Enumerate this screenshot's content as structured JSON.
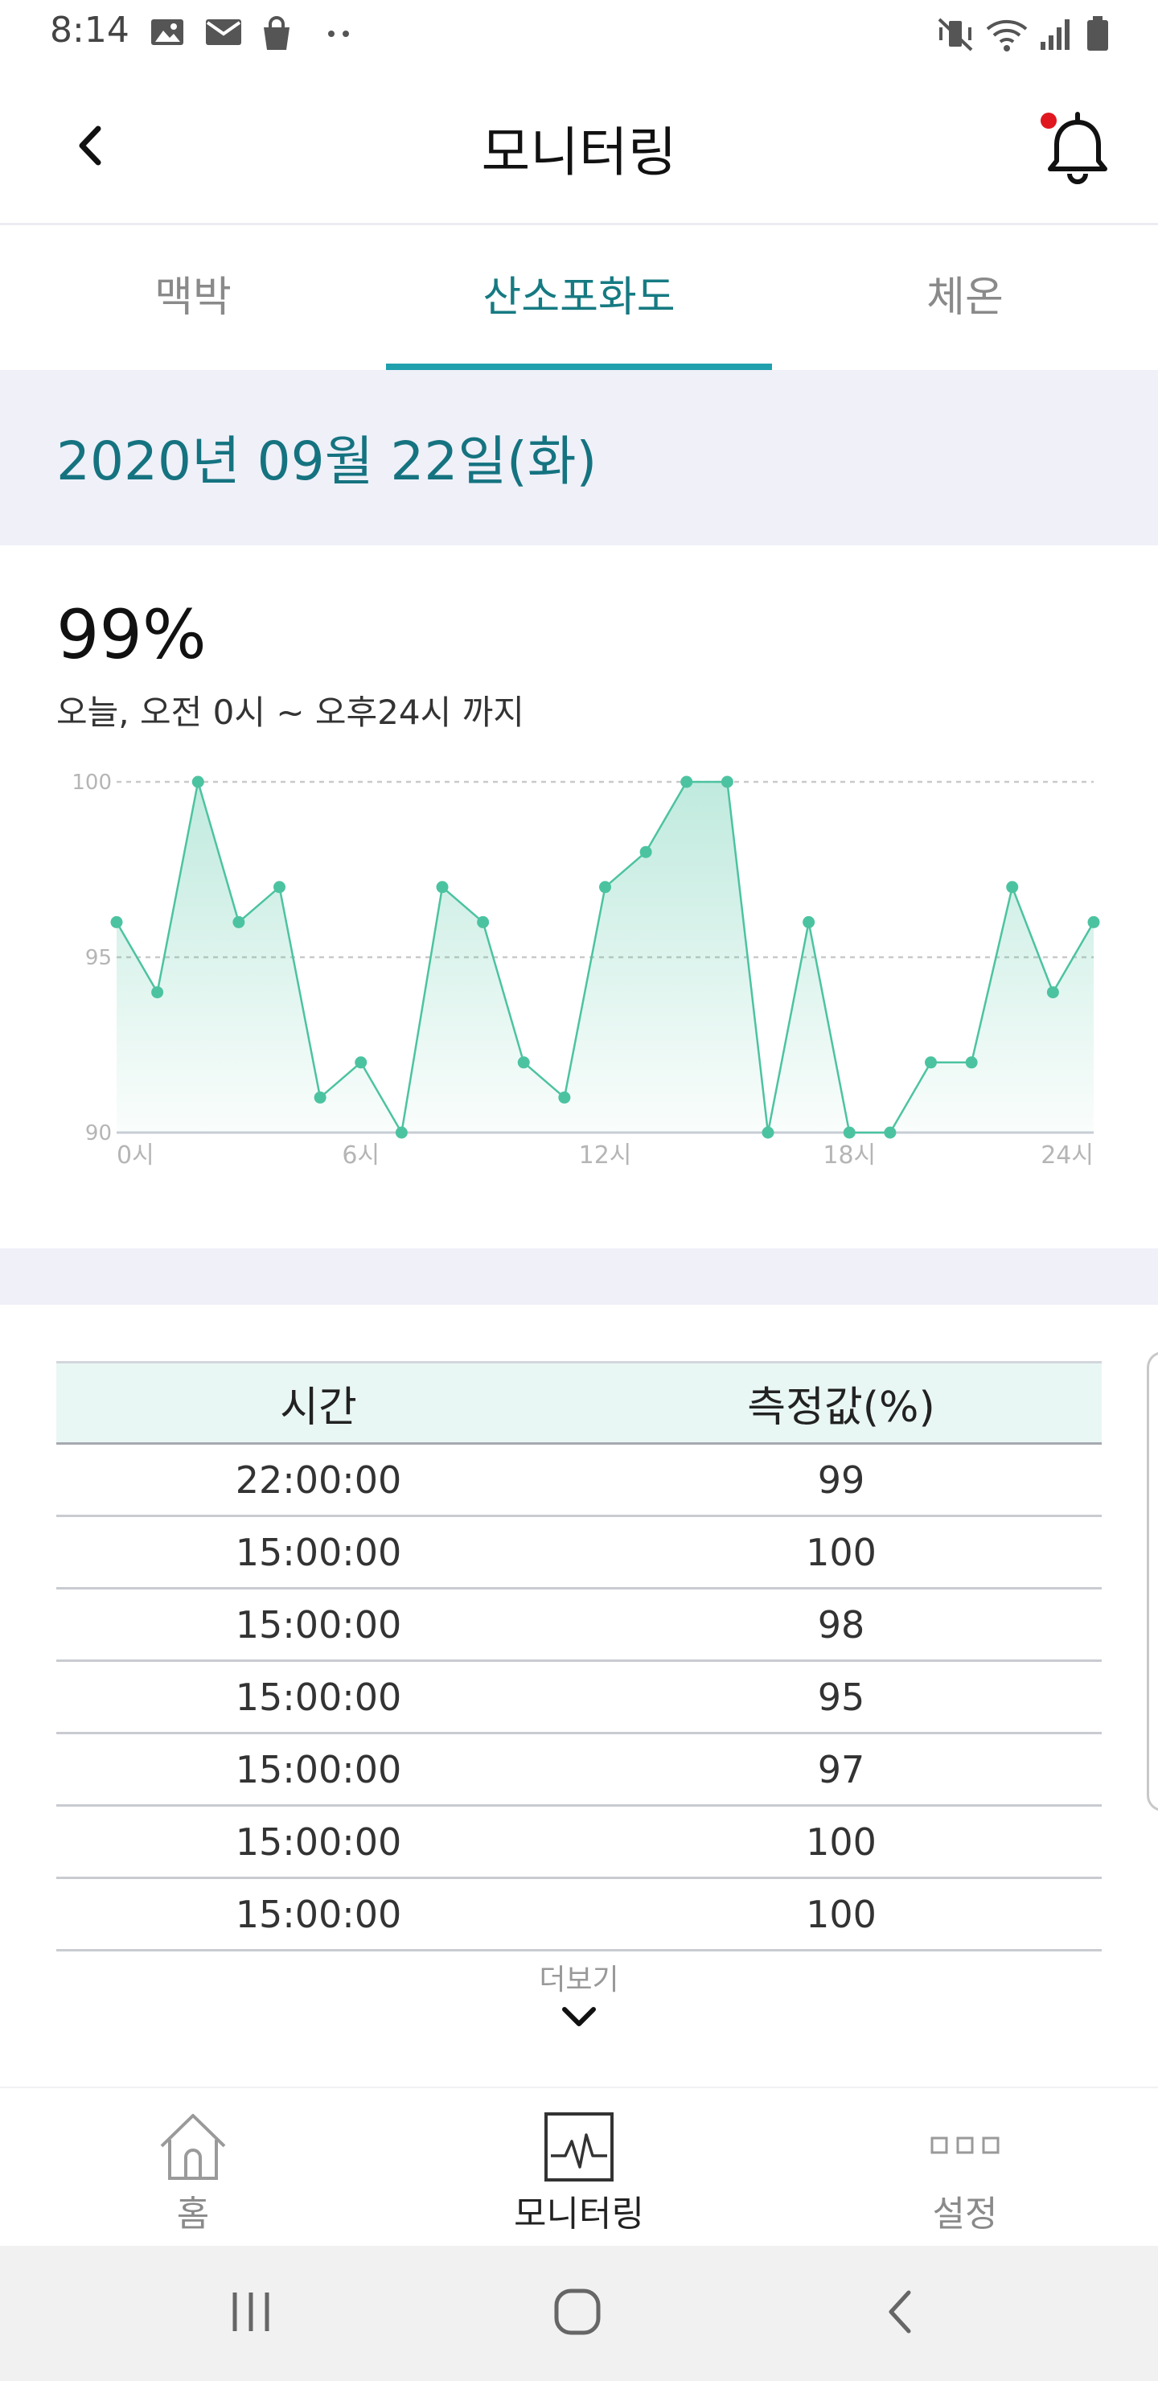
{
  "status_bar": {
    "time": "8:14"
  },
  "header": {
    "title": "모니터링"
  },
  "tabs": [
    {
      "label": "맥박",
      "active": false
    },
    {
      "label": "산소포화도",
      "active": true
    },
    {
      "label": "체온",
      "active": false
    }
  ],
  "date": "2020년 09월 22일(화)",
  "summary": {
    "value": "99%",
    "range": "오늘, 오전 0시 ~ 오후24시 까지"
  },
  "chart_data": {
    "type": "area",
    "x": [
      0,
      1,
      2,
      3,
      4,
      5,
      6,
      7,
      8,
      9,
      10,
      11,
      12,
      13,
      14,
      15,
      16,
      17,
      18,
      19,
      20,
      21,
      22,
      23,
      24
    ],
    "values": [
      96,
      94,
      100,
      96,
      97,
      91,
      92,
      90,
      97,
      96,
      92,
      91,
      97,
      98,
      100,
      100,
      90,
      96,
      90,
      90,
      92,
      92,
      97,
      94,
      96
    ],
    "x_ticks": [
      {
        "x": 0,
        "label": "0시"
      },
      {
        "x": 6,
        "label": "6시"
      },
      {
        "x": 12,
        "label": "12시"
      },
      {
        "x": 18,
        "label": "18시"
      },
      {
        "x": 24,
        "label": "24시"
      }
    ],
    "y_ticks": [
      "90",
      "95",
      "100"
    ],
    "ylim": [
      90,
      100
    ],
    "xlim": [
      0,
      24
    ],
    "grid": "dashed horizontal at 95 and 100",
    "color": "#4cc3a0"
  },
  "table": {
    "headers": [
      "시간",
      "측정값(%)"
    ],
    "rows": [
      [
        "22:00:00",
        "99"
      ],
      [
        "15:00:00",
        "100"
      ],
      [
        "15:00:00",
        "98"
      ],
      [
        "15:00:00",
        "95"
      ],
      [
        "15:00:00",
        "97"
      ],
      [
        "15:00:00",
        "100"
      ],
      [
        "15:00:00",
        "100"
      ]
    ]
  },
  "more_label": "더보기",
  "bottom_nav": [
    {
      "label": "홈",
      "icon": "home-icon",
      "active": false
    },
    {
      "label": "모니터링",
      "icon": "monitoring-icon",
      "active": true
    },
    {
      "label": "설정",
      "icon": "settings-icon",
      "active": false
    }
  ],
  "colors": {
    "accent": "#20a0ad",
    "title_teal": "#157380",
    "chart": "#4cc3a0",
    "band": "#eff0f8",
    "notification_dot": "#e0171f"
  }
}
